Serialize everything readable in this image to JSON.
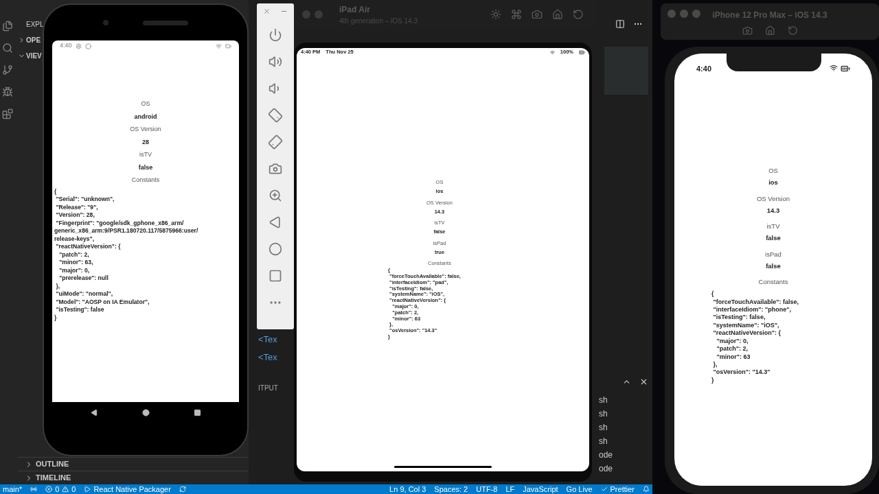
{
  "vscode": {
    "explorer_title": "EXPL",
    "sections": [
      {
        "label": "OPE",
        "expanded": false
      },
      {
        "label": "VIEV",
        "expanded": true
      }
    ],
    "bottom_sections": [
      {
        "label": "OUTLINE",
        "expanded": false
      },
      {
        "label": "TIMELINE",
        "expanded": false
      }
    ],
    "editor_fragments": [
      "<Tex",
      "<Tex"
    ],
    "panel_tab": "ITPUT",
    "terminal_fragments": [
      "sh",
      "sh",
      "sh",
      "sh",
      "ode",
      "ode"
    ],
    "status_bar": {
      "branch": "main*",
      "errors": "0",
      "warnings": "0",
      "packager": "React Native Packager",
      "position": "Ln 9, Col 3",
      "spaces": "Spaces: 2",
      "encoding": "UTF-8",
      "eol": "LF",
      "language": "JavaScript",
      "live": "Go Live",
      "formatter": "Prettier"
    }
  },
  "android": {
    "status_time": "4:40",
    "fields": [
      {
        "label": "OS",
        "value": "android"
      },
      {
        "label": "OS Version",
        "value": "28"
      },
      {
        "label": "isTV",
        "value": "false"
      }
    ],
    "constants_label": "Constants",
    "constants_lines": [
      "{",
      " \"Serial\": \"unknown\",",
      " \"Release\": \"9\",",
      " \"Version\": 28,",
      " \"Fingerprint\": \"google/sdk_gphone_x86_arm/",
      "generic_x86_arm:9/PSR1.180720.117/5875966:user/",
      "release-keys\",",
      " \"reactNativeVersion\": {",
      "   \"patch\": 2,",
      "   \"minor\": 63,",
      "   \"major\": 0,",
      "   \"prerelease\": null",
      " },",
      " \"uiMode\": \"normal\",",
      " \"Model\": \"AOSP on IA Emulator\",",
      " \"isTesting\": false",
      "}"
    ]
  },
  "ipad": {
    "title": "iPad Air",
    "subtitle": "4th generation – iOS 14.3",
    "status_time": "4:40 PM",
    "status_date": "Thu Nov 25",
    "battery": "100%",
    "fields": [
      {
        "label": "OS",
        "value": "ios"
      },
      {
        "label": "OS Version",
        "value": "14.3"
      },
      {
        "label": "isTV",
        "value": "false"
      },
      {
        "label": "isPad",
        "value": "true"
      }
    ],
    "constants_label": "Constants",
    "constants_lines": [
      "{",
      " \"forceTouchAvailable\": false,",
      " \"interfaceIdiom\": \"pad\",",
      " \"isTesting\": false,",
      " \"systemName\": \"iOS\",",
      " \"reactNativeVersion\": {",
      "   \"major\": 0,",
      "   \"patch\": 2,",
      "   \"minor\": 63",
      " },",
      " \"osVersion\": \"14.3\"",
      "}"
    ]
  },
  "iphone": {
    "title": "iPhone 12 Pro Max – iOS 14.3",
    "status_time": "4:40",
    "fields": [
      {
        "label": "OS",
        "value": "ios"
      },
      {
        "label": "OS Version",
        "value": "14.3"
      },
      {
        "label": "isTV",
        "value": "false"
      },
      {
        "label": "isPad",
        "value": "false"
      }
    ],
    "constants_label": "Constants",
    "constants_lines": [
      "{",
      " \"forceTouchAvailable\": false,",
      " \"interfaceIdiom\": \"phone\",",
      " \"isTesting\": false,",
      " \"systemName\": \"iOS\",",
      " \"reactNativeVersion\": {",
      "   \"major\": 0,",
      "   \"patch\": 2,",
      "   \"minor\": 63",
      " },",
      " \"osVersion\": \"14.3\"",
      "}"
    ]
  }
}
